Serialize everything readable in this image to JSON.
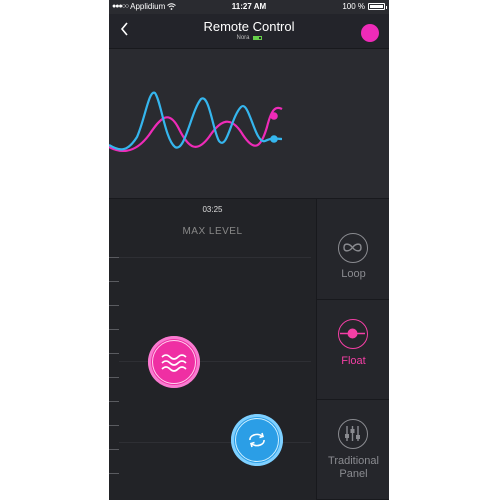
{
  "status_bar": {
    "carrier": "Applidium",
    "time": "11:27 AM",
    "battery_text": "100 %",
    "battery_level": 1.0
  },
  "nav": {
    "title": "Remote Control",
    "device_name": "Nora",
    "device_battery_level": 0.8
  },
  "player": {
    "elapsed": "03:25",
    "level_label": "MAX LEVEL"
  },
  "modes": [
    {
      "label": "Loop",
      "icon": "loop-icon",
      "active": false
    },
    {
      "label": "Float",
      "icon": "float-icon",
      "active": true
    },
    {
      "label": "Traditional Panel",
      "icon": "sliders-icon",
      "active": false
    }
  ],
  "colors": {
    "pink": "#ee2bb8",
    "blue": "#35b6ee",
    "background": "#2a2b30"
  }
}
